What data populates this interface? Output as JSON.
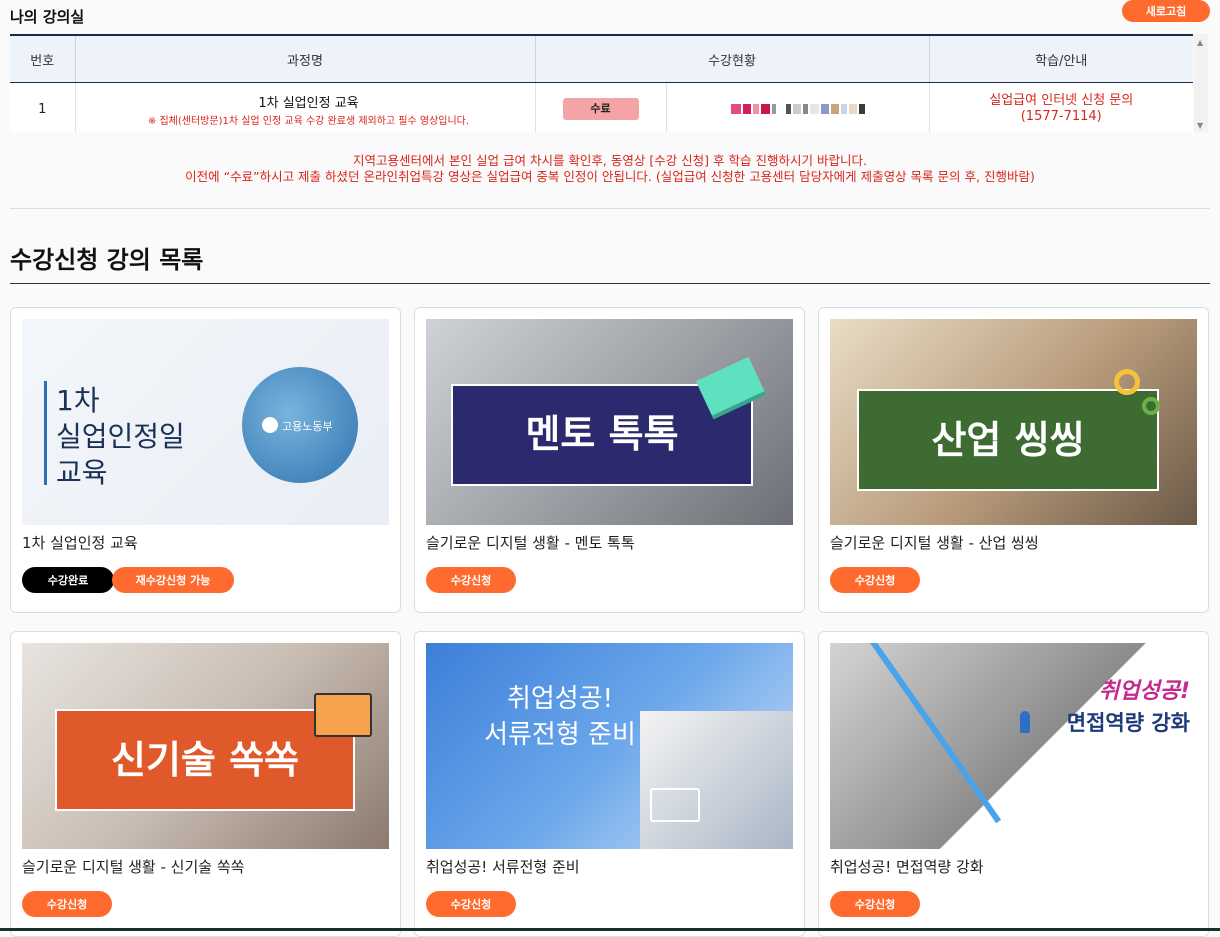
{
  "header": {
    "title": "나의 강의실",
    "refresh_label": "새로고침"
  },
  "table": {
    "columns": [
      "번호",
      "과정명",
      "수강현황",
      "학습/안내"
    ],
    "rows": [
      {
        "no": "1",
        "course": "1차 실업인정 교육",
        "note": "※ 집체(센터방문)1차 실업 인정 교육 수강 완료생 제외하고 필수 영상입니다.",
        "status": "수료",
        "inquiry_line1": "실업급여 인터넷 신청 문의",
        "inquiry_line2": "(1577-7114)"
      }
    ]
  },
  "notice": {
    "line1": "지역고용센터에서 본인 실업 급여 차시를 확인후, 동영상 [수강 신청] 후 학습 진행하시기 바랍니다.",
    "line2": "이전에 “수료”하시고 제출 하셨던 온라인취업특강 영상은 실업급여 중복 인정이 안됩니다. (실업급여 신청한 고용센터 담당자에게 제출영상 목록 문의 후, 진행바람)"
  },
  "section_title": "수강신청 강의 목록",
  "cards": [
    {
      "title": "1차 실업인정 교육",
      "thumb_lines": [
        "1차",
        "실업인정일",
        "교육"
      ],
      "logo_text": "고용노동부",
      "badge_done": "수강완료",
      "badge_reapply": "재수강신청 가능"
    },
    {
      "title": "슬기로운 디지털 생활 - 멘토 톡톡",
      "thumb_text": "멘토 톡톡",
      "button": "수강신청"
    },
    {
      "title": "슬기로운 디지털 생활 - 산업 씽씽",
      "thumb_text": "산업 씽씽",
      "button": "수강신청"
    },
    {
      "title": "슬기로운 디지털 생활 - 신기술 쏙쏙",
      "thumb_text": "신기술 쏙쏙",
      "button": "수강신청"
    },
    {
      "title": "취업성공! 서류전형 준비",
      "thumb_lines": [
        "취업성공!",
        "서류전형 준비"
      ],
      "button": "수강신청"
    },
    {
      "title": "취업성공! 면접역량 강화",
      "thumb_lines": [
        "취업성공!",
        "면접역량 강화"
      ],
      "button": "수강신청"
    }
  ],
  "colors": {
    "accent": "#ff6a2f",
    "notice_red": "#d9261c",
    "table_header_bg": "#eef3fa"
  }
}
